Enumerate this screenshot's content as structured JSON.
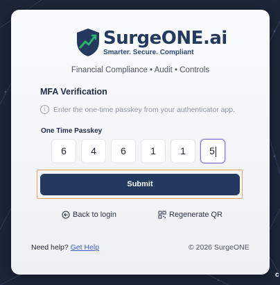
{
  "brand": {
    "name_main": "SurgeONE",
    "name_suffix": ".ai",
    "tagline": "Smarter. Secure. Compliant"
  },
  "subtitle": "Financial Compliance • Audit • Controls",
  "mfa": {
    "title": "MFA Verification",
    "info_text": "Enter the one-time passkey from your authenticator app.",
    "otp_label": "One Time Passkey",
    "otp_digits": [
      "6",
      "4",
      "6",
      "1",
      "1",
      "5"
    ],
    "active_index": 5
  },
  "actions": {
    "submit_label": "Submit",
    "back_label": "Back to login",
    "regenerate_label": "Regenerate QR"
  },
  "footer": {
    "help_prefix": "Need help?",
    "help_link": "Get Help",
    "copyright": "© 2026 SurgeONE"
  },
  "corner_glyph": "c",
  "colors": {
    "background": "#1c2639",
    "brand_navy": "#233a5e",
    "accent_green": "#2fb06b",
    "focus_orange": "#f1a15f",
    "otp_active_border": "#8a7ad6",
    "link_blue": "#3b5ed6"
  },
  "icons": {
    "info": "info-circle-icon",
    "back": "arrow-left-circle-icon",
    "regenerate": "qr-code-icon",
    "logo": "shield-chart-icon"
  }
}
